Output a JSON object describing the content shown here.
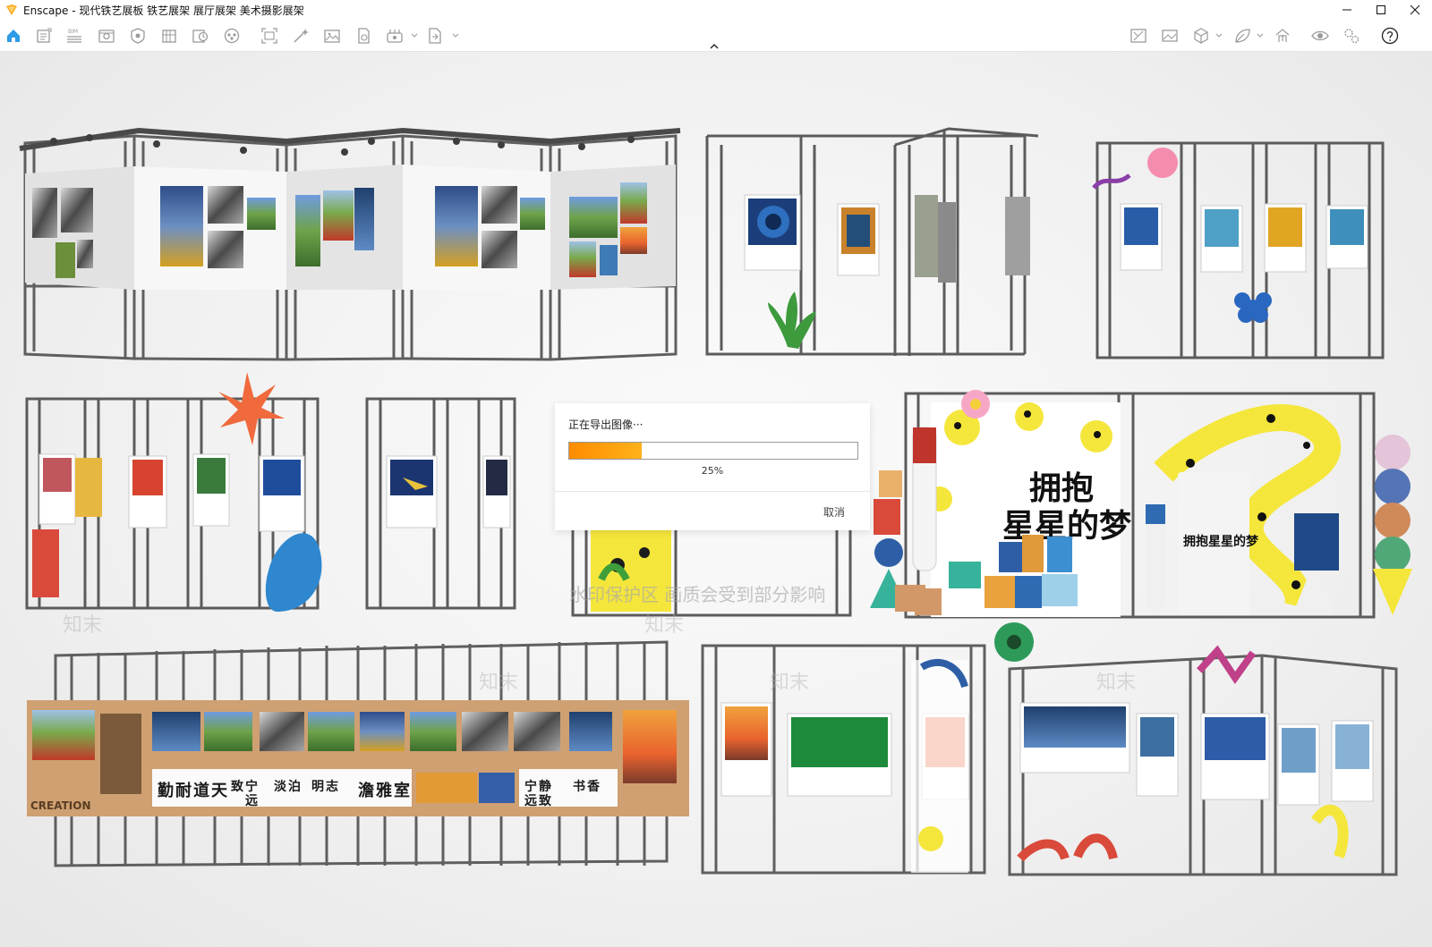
{
  "window": {
    "app_name": "Enscape",
    "document_title": "现代铁艺展板 铁艺展架 展厅展架 美术摄影展架",
    "title_separator": " - ",
    "controls": [
      "minimize-icon",
      "maximize-icon",
      "close-icon"
    ]
  },
  "toolbar": {
    "left_icons": [
      "home-icon",
      "views-icon",
      "bim-icon",
      "visual-settings-icon",
      "assets-icon",
      "materials-icon",
      "sites-icon",
      "vr-icon",
      "screenshot-icon",
      "batch-render-icon",
      "image-icon",
      "panorama-icon",
      "video-icon",
      "export-icon"
    ],
    "bim_label": "BIM",
    "right_icons": [
      "web-standalone-icon",
      "image-export-icon",
      "cube-icon",
      "leaf-icon",
      "upload-icon",
      "view-icon",
      "settings-icon",
      "help-icon"
    ]
  },
  "scene": {
    "poster_title_line1": "拥抱",
    "poster_title_line2": "星星的梦",
    "small_poster_title": "拥抱星星的梦",
    "calligraphy": [
      "勤",
      "耐",
      "道",
      "天",
      "致",
      "宁",
      "远",
      "淡",
      "泊",
      "明",
      "志",
      "澹",
      "雅",
      "室",
      "宁",
      "静",
      "致",
      "远",
      "书",
      "香"
    ],
    "creation_label": "CREATION",
    "watermark": "水印保护区 画质会受到部分影响",
    "watermark_brand": "知末"
  },
  "export_dialog": {
    "title": "正在导出图像···",
    "progress": 0.25,
    "progress_label": "25%",
    "cancel_label": "取消",
    "colors": {
      "fill_start": "#ff8c00",
      "fill_end": "#ffb21a"
    }
  },
  "colors": {
    "frame": "#5a5a5a",
    "accent_yellow": "#f5e63c",
    "accent_blue": "#1f5aa8"
  }
}
